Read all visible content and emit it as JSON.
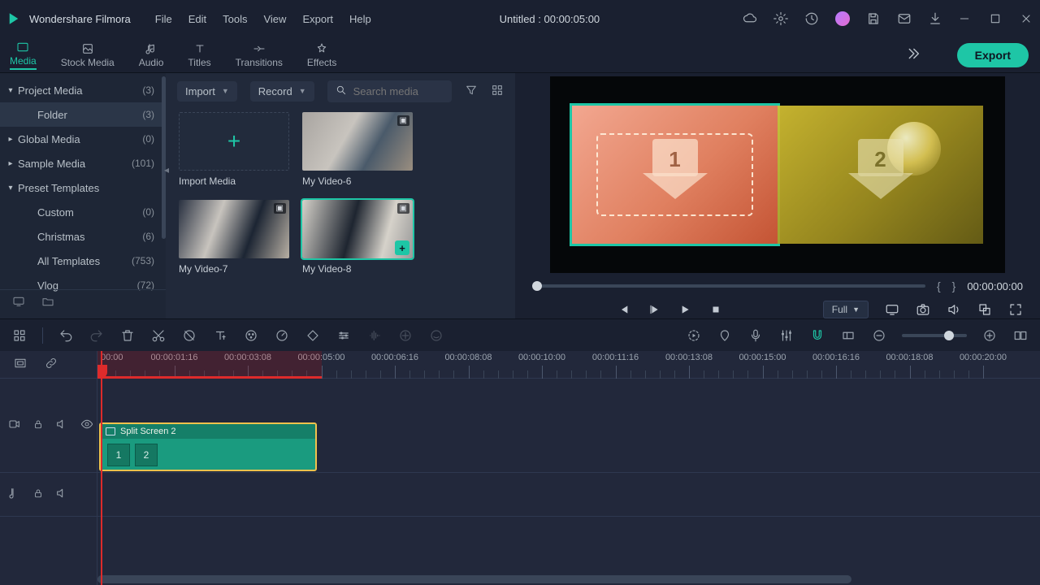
{
  "app": {
    "name": "Wondershare Filmora",
    "document": "Untitled : 00:00:05:00"
  },
  "menu": [
    "File",
    "Edit",
    "Tools",
    "View",
    "Export",
    "Help"
  ],
  "tabs": [
    {
      "id": "media",
      "label": "Media"
    },
    {
      "id": "stock",
      "label": "Stock Media"
    },
    {
      "id": "audio",
      "label": "Audio"
    },
    {
      "id": "titles",
      "label": "Titles"
    },
    {
      "id": "transitions",
      "label": "Transitions"
    },
    {
      "id": "effects",
      "label": "Effects"
    }
  ],
  "export_label": "Export",
  "sidebar": {
    "items": [
      {
        "label": "Project Media",
        "count": "(3)",
        "expanded": true
      },
      {
        "label": "Folder",
        "count": "(3)",
        "child": true,
        "selected": true
      },
      {
        "label": "Global Media",
        "count": "(0)"
      },
      {
        "label": "Sample Media",
        "count": "(101)"
      },
      {
        "label": "Preset Templates",
        "expanded": true
      },
      {
        "label": "Custom",
        "count": "(0)",
        "child": true
      },
      {
        "label": "Christmas",
        "count": "(6)",
        "child": true
      },
      {
        "label": "All Templates",
        "count": "(753)",
        "child": true
      },
      {
        "label": "Vlog",
        "count": "(72)",
        "child": true
      }
    ]
  },
  "browser": {
    "import": "Import",
    "record": "Record",
    "search_placeholder": "Search media",
    "clips": [
      {
        "id": "import",
        "label": "Import Media"
      },
      {
        "id": "v6",
        "label": "My Video-6"
      },
      {
        "id": "v7",
        "label": "My Video-7"
      },
      {
        "id": "v8",
        "label": "My Video-8",
        "selected": true
      }
    ]
  },
  "preview": {
    "split": {
      "pane1_num": "1",
      "pane2_num": "2"
    },
    "markin": "{",
    "markout": "}",
    "timecode": "00:00:00:00",
    "resolution": "Full"
  },
  "timeline": {
    "ticks": [
      "00:00",
      "00:00:01:16",
      "00:00:03:08",
      "00:00:05:00",
      "00:00:06:16",
      "00:00:08:08",
      "00:00:10:00",
      "00:00:11:16",
      "00:00:13:08",
      "00:00:15:00",
      "00:00:16:16",
      "00:00:18:08",
      "00:00:20:00"
    ],
    "clip": {
      "name": "Split Screen 2",
      "cells": [
        "1",
        "2"
      ]
    }
  }
}
